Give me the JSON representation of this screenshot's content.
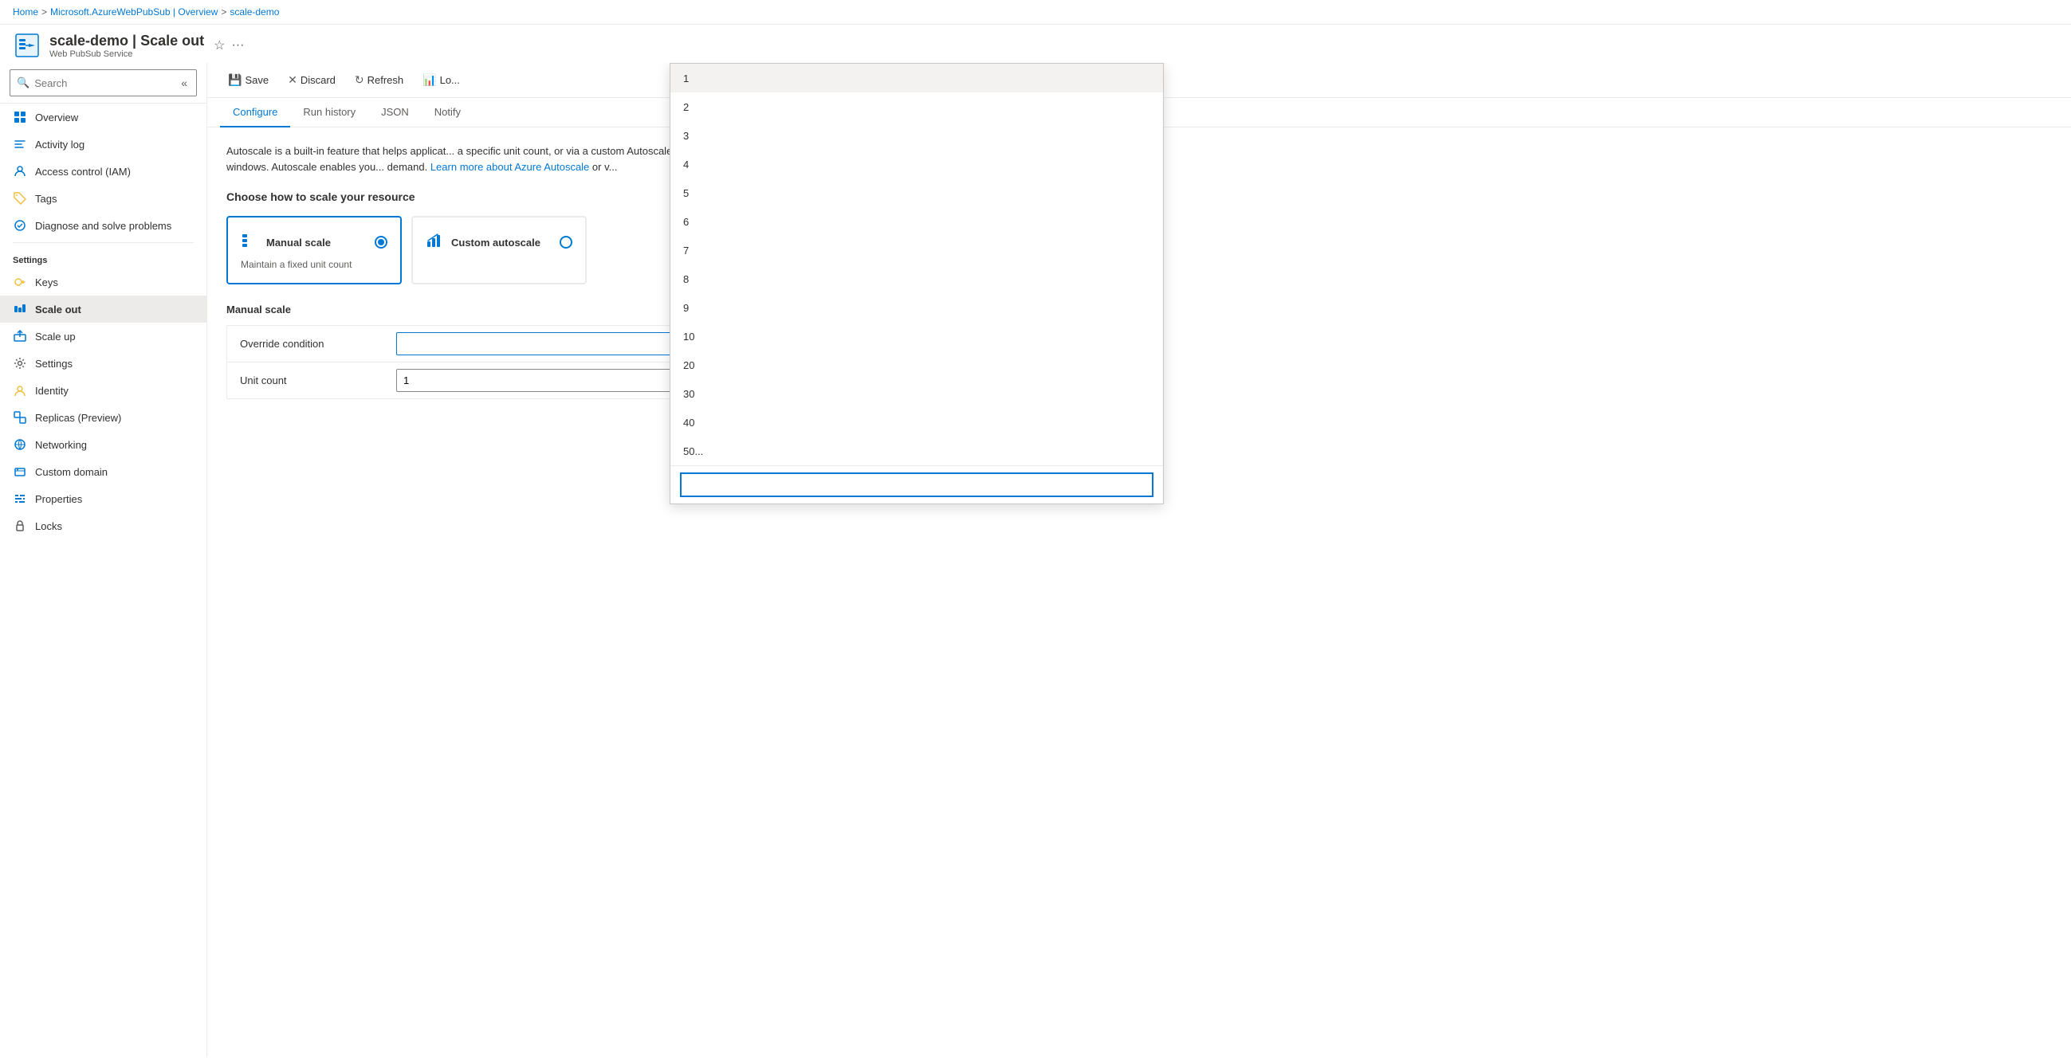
{
  "breadcrumb": {
    "home": "Home",
    "separator1": ">",
    "parent": "Microsoft.AzureWebPubSub | Overview",
    "separator2": ">",
    "current": "scale-demo"
  },
  "header": {
    "title": "scale-demo | Scale out",
    "subtitle": "Web PubSub Service"
  },
  "toolbar": {
    "save_label": "Save",
    "discard_label": "Discard",
    "refresh_label": "Refresh",
    "logs_label": "Lo..."
  },
  "tabs": [
    {
      "label": "Configure",
      "active": true
    },
    {
      "label": "Run history",
      "active": false
    },
    {
      "label": "JSON",
      "active": false
    },
    {
      "label": "Notify",
      "active": false
    }
  ],
  "sidebar": {
    "search_placeholder": "Search",
    "nav_items": [
      {
        "label": "Overview",
        "icon": "overview"
      },
      {
        "label": "Activity log",
        "icon": "activity"
      },
      {
        "label": "Access control (IAM)",
        "icon": "iam"
      },
      {
        "label": "Tags",
        "icon": "tags"
      },
      {
        "label": "Diagnose and solve problems",
        "icon": "diagnose"
      }
    ],
    "settings_section": "Settings",
    "settings_items": [
      {
        "label": "Keys",
        "icon": "keys"
      },
      {
        "label": "Scale out",
        "icon": "scaleout",
        "active": true
      },
      {
        "label": "Scale up",
        "icon": "scaleup"
      },
      {
        "label": "Settings",
        "icon": "settings"
      },
      {
        "label": "Identity",
        "icon": "identity"
      },
      {
        "label": "Replicas (Preview)",
        "icon": "replicas"
      },
      {
        "label": "Networking",
        "icon": "networking"
      },
      {
        "label": "Custom domain",
        "icon": "domain"
      },
      {
        "label": "Properties",
        "icon": "properties"
      },
      {
        "label": "Locks",
        "icon": "locks"
      }
    ]
  },
  "description": {
    "text1": "Autoscale is a built-in feature that helps applicat... a specific unit count, or via a custom Autoscale p... designated time windows. Autoscale enables you... demand.",
    "link_text": "Learn more about Azure Autoscale",
    "text2": "or v..."
  },
  "choose_scale_title": "Choose how to scale your resource",
  "manual_scale": {
    "title": "Manual scale",
    "subtitle": "Maintain a fixed unit count",
    "selected": true
  },
  "custom_scale": {
    "title": "Custom autoscale",
    "selected": false
  },
  "manual_scale_section_title": "Manual scale",
  "form": {
    "override_label": "Override condition",
    "override_value": "",
    "unit_count_label": "Unit count",
    "unit_count_value": "1"
  },
  "dropdown": {
    "items": [
      "1",
      "2",
      "3",
      "4",
      "5",
      "6",
      "7",
      "8",
      "9",
      "10",
      "20",
      "30",
      "40",
      "50"
    ],
    "search_value": ""
  }
}
